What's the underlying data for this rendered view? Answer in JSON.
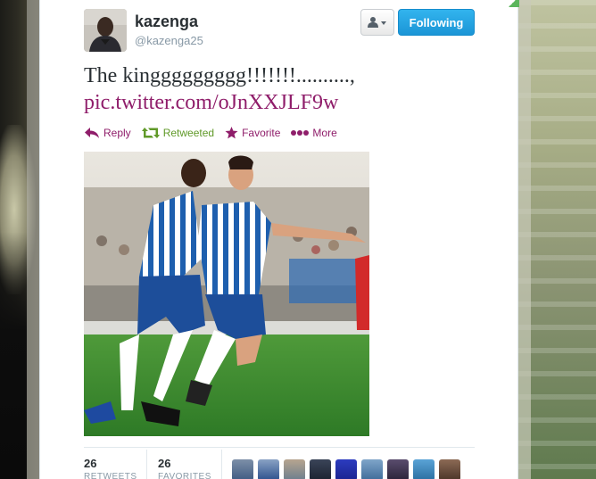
{
  "tweet": {
    "user": {
      "name": "kazenga",
      "handle": "@kazenga25"
    },
    "header": {
      "follow_label": "Following",
      "user_menu_icon": "user-dropdown-icon"
    },
    "text": "The kinggggggggg!!!!!!!..........,",
    "link": "pic.twitter.com/oJnXXJLF9w",
    "actions": {
      "reply": "Reply",
      "retweet": "Retweeted",
      "favorite": "Favorite",
      "more": "More"
    },
    "stats": {
      "retweets_count": "26",
      "retweets_label": "RETWEETS",
      "favorites_count": "26",
      "favorites_label": "FAVORITES"
    },
    "favoriter_avatar_count": 10
  },
  "colors": {
    "link": "#8f1d6a",
    "retweeted": "#609928",
    "follow_button": "#1b95d6",
    "text": "#292f33",
    "muted": "#8899a6"
  }
}
